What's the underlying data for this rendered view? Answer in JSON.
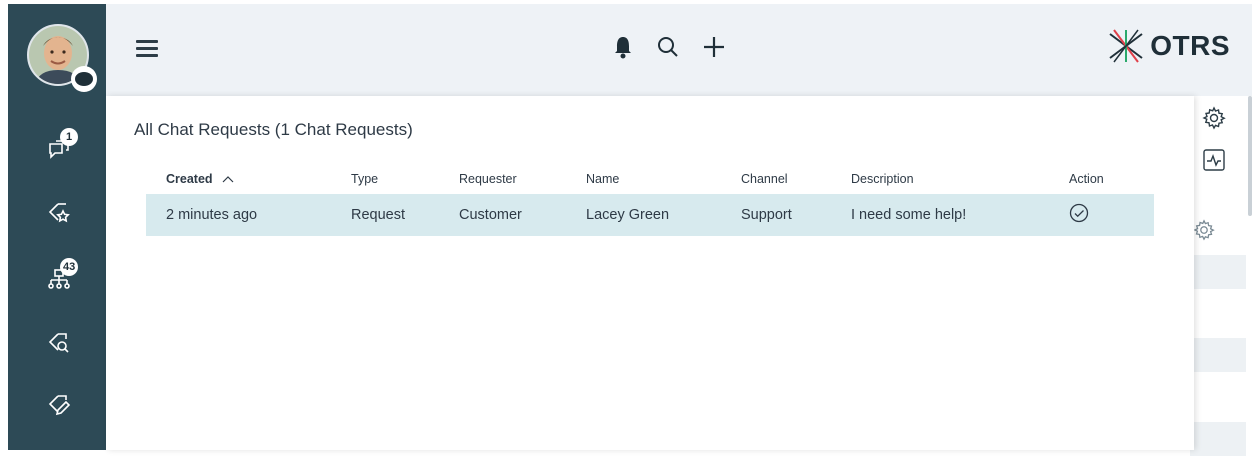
{
  "sidebar": {
    "chat_badge": "1",
    "tree_badge": "43"
  },
  "topbar": {
    "logo_text": "OTRS"
  },
  "overlay": {
    "title": "All Chat Requests (1 Chat Requests)",
    "columns": [
      "Created",
      "Type",
      "Requester",
      "Name",
      "Channel",
      "Description",
      "Action"
    ],
    "sorted_column_indicator": "^",
    "rows": [
      {
        "created": "2 minutes ago",
        "type": "Request",
        "requester": "Customer",
        "name": "Lacey Green",
        "channel": "Support",
        "description": "I need some help!"
      }
    ]
  },
  "colors": {
    "sidebar_bg": "#2d4a56",
    "topbar_bg": "#eef2f6",
    "row_highlight": "#d7eaee",
    "logo_accent": "#e0414a"
  },
  "icons": {
    "avatar": "user-avatar",
    "chat": "chat-bubbles-icon",
    "ticket_star": "ticket-star-icon",
    "tree": "org-tree-icon",
    "ticket_search": "ticket-search-icon",
    "ticket_edit": "ticket-edit-icon",
    "bell": "bell-icon",
    "search": "search-icon",
    "plus": "plus-icon",
    "check": "check-circle-icon",
    "gear": "gear-icon",
    "activity": "activity-icon"
  }
}
